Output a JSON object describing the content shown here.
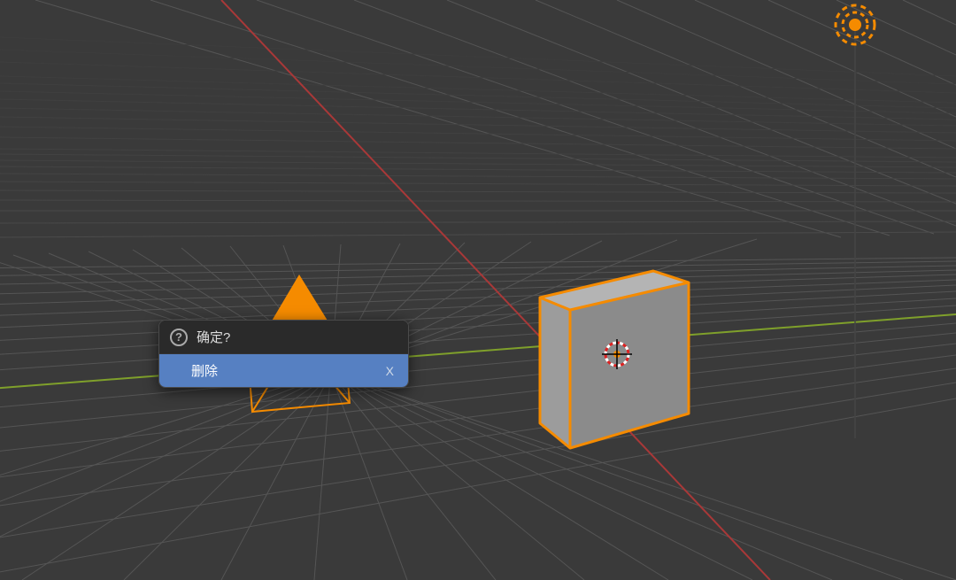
{
  "popup": {
    "title": "确定?",
    "action_label": "删除",
    "shortcut": "X"
  },
  "colors": {
    "grid": "#555555",
    "grid_minor": "#4a4a4a",
    "background": "#3a3a3a",
    "axis_x": "#a93838",
    "axis_y": "#7fa02b",
    "selection_outline": "#f58b00",
    "cube_fill": "#a0a0a0",
    "popup_bg": "#1f1f1f",
    "popup_action_bg": "#5680c2"
  },
  "scene": {
    "objects": [
      "cube",
      "camera",
      "light",
      "cursor"
    ],
    "selected": [
      "cube",
      "camera",
      "light"
    ]
  }
}
